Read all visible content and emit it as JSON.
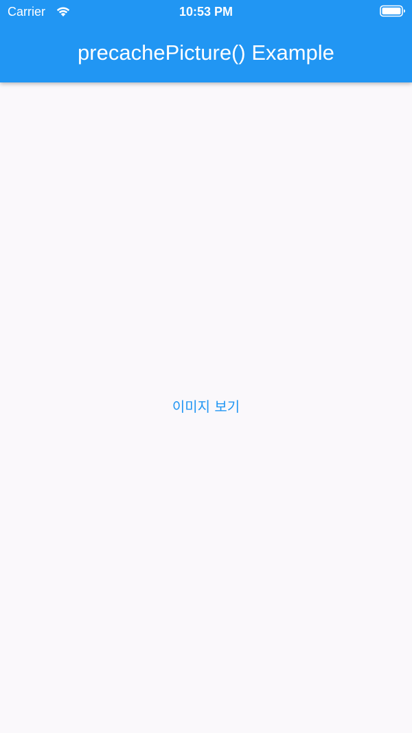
{
  "status_bar": {
    "carrier": "Carrier",
    "time": "10:53 PM",
    "wifi_icon": "wifi-icon",
    "battery_icon": "battery-icon"
  },
  "app_bar": {
    "title": "precachePicture() Example",
    "color": "#2196f3"
  },
  "main": {
    "button_label": "이미지 보기",
    "background": "#faf8fb"
  }
}
